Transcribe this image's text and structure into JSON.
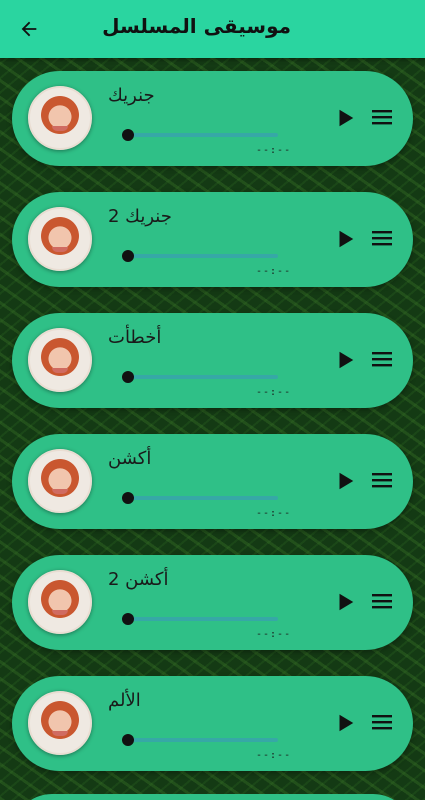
{
  "appbar": {
    "title": "موسيقى المسلسل",
    "back_icon": "arrow-left-icon"
  },
  "colors": {
    "appbar": "#2ad5a0",
    "card": "#2fc087",
    "seek_track": "#36a8a6"
  },
  "tracks": [
    {
      "title": "جنريك",
      "time": "--:--",
      "progress": 0
    },
    {
      "title": "جنريك 2",
      "time": "--:--",
      "progress": 0
    },
    {
      "title": "أخطأت",
      "time": "--:--",
      "progress": 0
    },
    {
      "title": "أكشن",
      "time": "--:--",
      "progress": 0
    },
    {
      "title": "أكشن 2",
      "time": "--:--",
      "progress": 0
    },
    {
      "title": "الألم",
      "time": "--:--",
      "progress": 0
    }
  ]
}
